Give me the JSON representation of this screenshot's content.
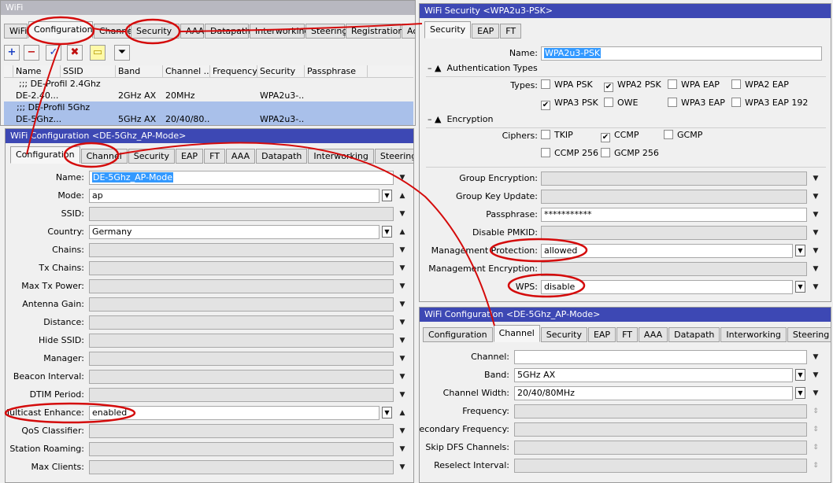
{
  "wifi_main": {
    "title": "WiFi",
    "tabs": [
      "WiFi",
      "Configuration",
      "Channe",
      "Security",
      "AAA",
      "Datapath",
      "Interworking",
      "Steering",
      "Registration",
      "Ac"
    ],
    "toolbar": {
      "add": "+",
      "remove": "−",
      "enable": "✓",
      "disable": "✖",
      "comment": "▭",
      "filter": "⏷"
    },
    "columns": [
      "",
      "Name",
      "SSID",
      "Band",
      "Channel ...",
      "Frequency",
      "Security",
      "Passphrase"
    ],
    "rows": [
      {
        "comment": ";;; DE-Profil 2.4Ghz"
      },
      {
        "name": "DE-2.40...",
        "band": "2GHz AX",
        "channel": "20MHz",
        "security": "WPA2u3-..."
      },
      {
        "comment": ";;; DE-Profil 5Ghz"
      },
      {
        "name": "DE-5Ghz...",
        "band": "5GHz AX",
        "channel": "20/40/80...",
        "security": "WPA2u3-..."
      }
    ]
  },
  "config_win": {
    "title": "WiFi Configuration <DE-5Ghz_AP-Mode>",
    "tabs": [
      "Configuration",
      "Channel",
      "Security",
      "EAP",
      "FT",
      "AAA",
      "Datapath",
      "Interworking",
      "Steering"
    ],
    "fields": [
      {
        "label": "Name:",
        "value": "DE-5Ghz_AP-Mode"
      },
      {
        "label": "Mode:",
        "value": "ap"
      },
      {
        "label": "SSID:",
        "value": ""
      },
      {
        "label": "Country:",
        "value": "Germany"
      },
      {
        "label": "Chains:",
        "value": ""
      },
      {
        "label": "Tx Chains:",
        "value": ""
      },
      {
        "label": "Max Tx Power:",
        "value": ""
      },
      {
        "label": "Antenna Gain:",
        "value": ""
      },
      {
        "label": "Distance:",
        "value": ""
      },
      {
        "label": "Hide SSID:",
        "value": ""
      },
      {
        "label": "Manager:",
        "value": ""
      },
      {
        "label": "Beacon Interval:",
        "value": ""
      },
      {
        "label": "DTIM Period:",
        "value": ""
      },
      {
        "label": "Multicast Enhance:",
        "value": "enabled"
      },
      {
        "label": "QoS Classifier:",
        "value": ""
      },
      {
        "label": "Station Roaming:",
        "value": ""
      },
      {
        "label": "Max Clients:",
        "value": ""
      }
    ]
  },
  "security_win": {
    "title": "WiFi Security <WPA2u3-PSK>",
    "tabs": [
      "Security",
      "EAP",
      "FT"
    ],
    "name_label": "Name:",
    "name_value": "WPA2u3-PSK",
    "auth_section": "Authentication Types",
    "types_label": "Types:",
    "auth_types": [
      {
        "label": "WPA PSK",
        "checked": false
      },
      {
        "label": "WPA2 PSK",
        "checked": true
      },
      {
        "label": "WPA EAP",
        "checked": false
      },
      {
        "label": "WPA2 EAP",
        "checked": false
      },
      {
        "label": "WPA3 PSK",
        "checked": true
      },
      {
        "label": "OWE",
        "checked": false
      },
      {
        "label": "WPA3 EAP",
        "checked": false
      },
      {
        "label": "WPA3 EAP 192",
        "checked": false
      }
    ],
    "enc_section": "Encryption",
    "ciphers_label": "Ciphers:",
    "ciphers": [
      {
        "label": "TKIP",
        "checked": false
      },
      {
        "label": "CCMP",
        "checked": true
      },
      {
        "label": "GCMP",
        "checked": false
      },
      {
        "label": "CCMP 256",
        "checked": false
      },
      {
        "label": "GCMP 256",
        "checked": false
      }
    ],
    "fields": [
      {
        "label": "Group Encryption:",
        "value": ""
      },
      {
        "label": "Group Key Update:",
        "value": ""
      },
      {
        "label": "Passphrase:",
        "value": "***********"
      },
      {
        "label": "Disable PMKID:",
        "value": ""
      },
      {
        "label": "Management Protection:",
        "value": "allowed"
      },
      {
        "label": "Management Encryption:",
        "value": ""
      },
      {
        "label": "WPS:",
        "value": "disable"
      }
    ]
  },
  "channel_win": {
    "title": "WiFi Configuration <DE-5Ghz_AP-Mode>",
    "tabs": [
      "Configuration",
      "Channel",
      "Security",
      "EAP",
      "FT",
      "AAA",
      "Datapath",
      "Interworking",
      "Steering"
    ],
    "fields": [
      {
        "label": "Channel:",
        "value": ""
      },
      {
        "label": "Band:",
        "value": "5GHz AX"
      },
      {
        "label": "Channel Width:",
        "value": "20/40/80MHz"
      },
      {
        "label": "Frequency:",
        "value": ""
      },
      {
        "label": "Secondary Frequency:",
        "value": ""
      },
      {
        "label": "Skip DFS Channels:",
        "value": ""
      },
      {
        "label": "Reselect Interval:",
        "value": ""
      }
    ]
  },
  "colors": {
    "title_active": "#3d48b4",
    "title_inactive": "#b8b8c0",
    "annotation": "#d40b0b",
    "selection": "#3399ff"
  }
}
